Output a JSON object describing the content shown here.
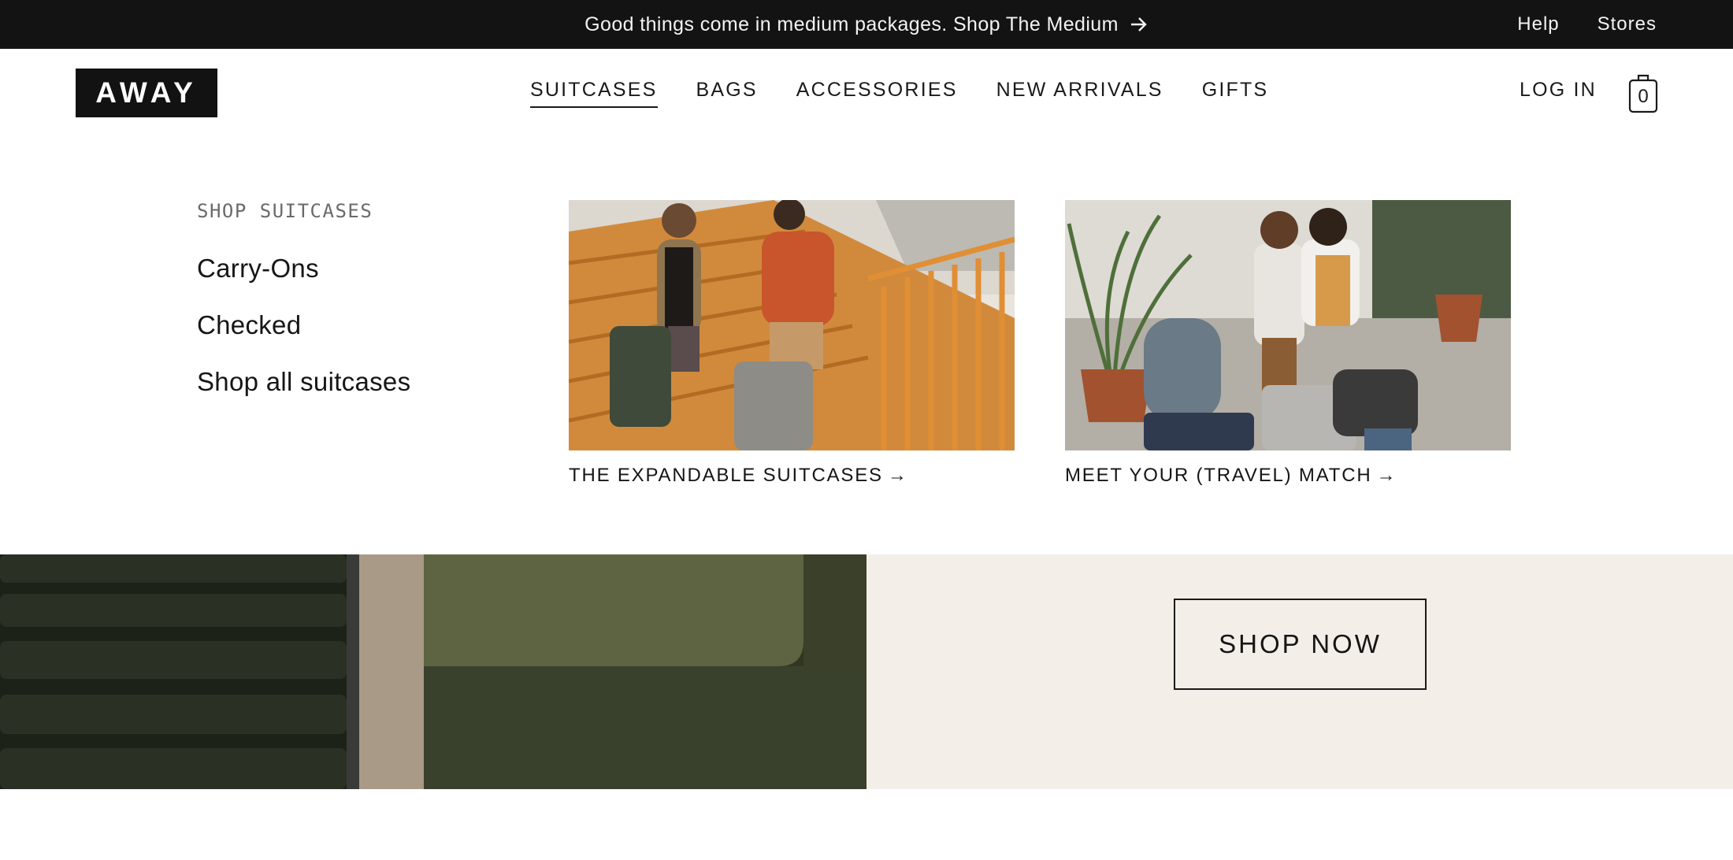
{
  "announcement": {
    "text": "Good things come in medium packages. Shop The Medium",
    "links": [
      "Help",
      "Stores"
    ]
  },
  "header": {
    "logo": "AWAY",
    "nav": [
      "SUITCASES",
      "BAGS",
      "ACCESSORIES",
      "NEW ARRIVALS",
      "GIFTS"
    ],
    "active_nav": "SUITCASES",
    "login": "LOG IN",
    "cart_count": "0"
  },
  "menu": {
    "heading": "SHOP SUITCASES",
    "links": [
      "Carry-Ons",
      "Checked",
      "Shop all suitcases"
    ],
    "cards": [
      {
        "caption": "THE EXPANDABLE SUITCASES"
      },
      {
        "caption": "MEET YOUR (TRAVEL) MATCH"
      }
    ]
  },
  "hero": {
    "cta": "SHOP NOW"
  },
  "colors": {
    "topbar": "#131313",
    "logo_bg": "#121212",
    "hero_right_bg": "#f3eee8",
    "hero_left_bg": "#2c3322"
  }
}
